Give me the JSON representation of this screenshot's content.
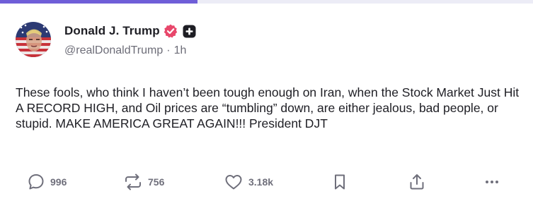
{
  "progress": {
    "fraction": 0.37
  },
  "author": {
    "display_name": "Donald J. Trump",
    "handle": "@realDonaldTrump",
    "separator": "·",
    "time": "1h"
  },
  "post": {
    "text": "These fools, who think I haven’t been tough enough on Iran, when the Stock Market Just Hit A RECORD HIGH, and Oil prices are “tumbling” down, are either jealous, bad people, or stupid. MAKE AMERICA GREAT AGAIN!!! President DJT"
  },
  "actions": {
    "replies": "996",
    "reposts": "756",
    "likes": "3.18k"
  },
  "icons": {
    "verified": "verified-badge-icon",
    "plus": "plus-badge-icon",
    "reply": "reply-icon",
    "repost": "repost-icon",
    "like": "heart-icon",
    "bookmark": "bookmark-icon",
    "share": "share-icon",
    "more": "more-icon"
  },
  "colors": {
    "accent": "#6f5ed8",
    "verified": "#e8476b",
    "text": "#1e1e24",
    "muted": "#6d6d78"
  }
}
